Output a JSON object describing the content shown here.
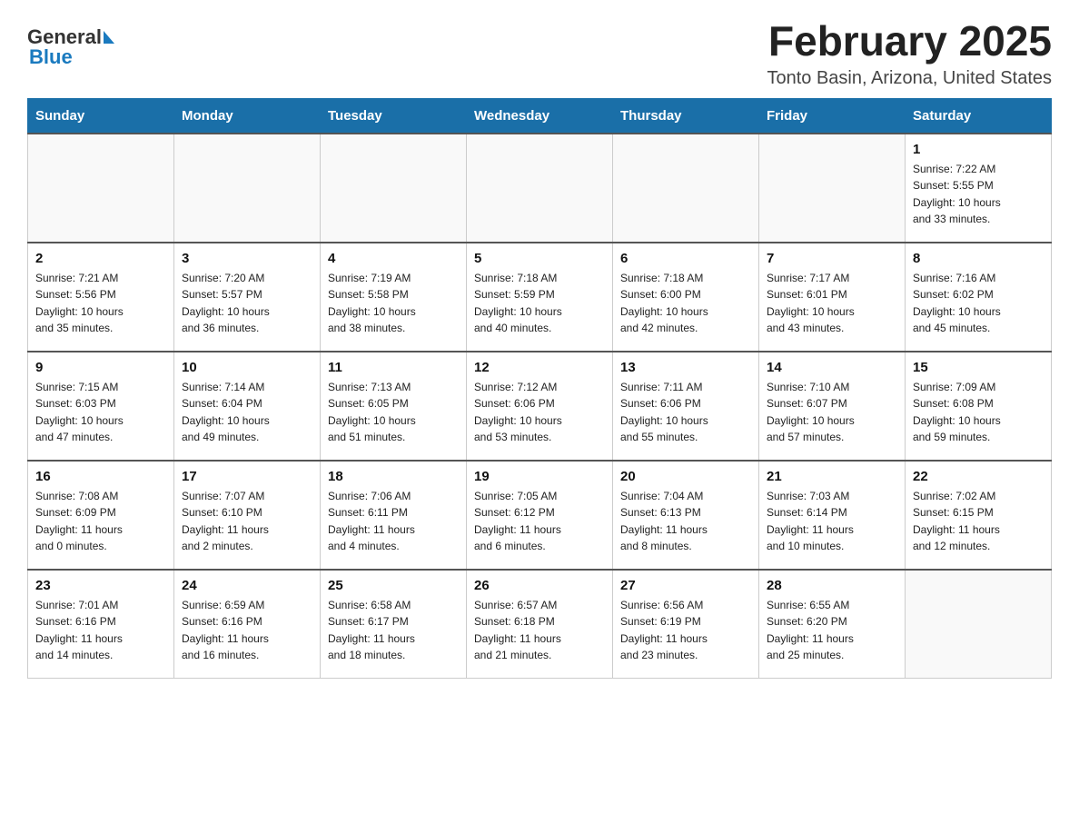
{
  "header": {
    "logo_general": "General",
    "logo_blue": "Blue",
    "month_title": "February 2025",
    "location": "Tonto Basin, Arizona, United States"
  },
  "days_of_week": [
    "Sunday",
    "Monday",
    "Tuesday",
    "Wednesday",
    "Thursday",
    "Friday",
    "Saturday"
  ],
  "weeks": [
    [
      {
        "day": "",
        "info": ""
      },
      {
        "day": "",
        "info": ""
      },
      {
        "day": "",
        "info": ""
      },
      {
        "day": "",
        "info": ""
      },
      {
        "day": "",
        "info": ""
      },
      {
        "day": "",
        "info": ""
      },
      {
        "day": "1",
        "info": "Sunrise: 7:22 AM\nSunset: 5:55 PM\nDaylight: 10 hours\nand 33 minutes."
      }
    ],
    [
      {
        "day": "2",
        "info": "Sunrise: 7:21 AM\nSunset: 5:56 PM\nDaylight: 10 hours\nand 35 minutes."
      },
      {
        "day": "3",
        "info": "Sunrise: 7:20 AM\nSunset: 5:57 PM\nDaylight: 10 hours\nand 36 minutes."
      },
      {
        "day": "4",
        "info": "Sunrise: 7:19 AM\nSunset: 5:58 PM\nDaylight: 10 hours\nand 38 minutes."
      },
      {
        "day": "5",
        "info": "Sunrise: 7:18 AM\nSunset: 5:59 PM\nDaylight: 10 hours\nand 40 minutes."
      },
      {
        "day": "6",
        "info": "Sunrise: 7:18 AM\nSunset: 6:00 PM\nDaylight: 10 hours\nand 42 minutes."
      },
      {
        "day": "7",
        "info": "Sunrise: 7:17 AM\nSunset: 6:01 PM\nDaylight: 10 hours\nand 43 minutes."
      },
      {
        "day": "8",
        "info": "Sunrise: 7:16 AM\nSunset: 6:02 PM\nDaylight: 10 hours\nand 45 minutes."
      }
    ],
    [
      {
        "day": "9",
        "info": "Sunrise: 7:15 AM\nSunset: 6:03 PM\nDaylight: 10 hours\nand 47 minutes."
      },
      {
        "day": "10",
        "info": "Sunrise: 7:14 AM\nSunset: 6:04 PM\nDaylight: 10 hours\nand 49 minutes."
      },
      {
        "day": "11",
        "info": "Sunrise: 7:13 AM\nSunset: 6:05 PM\nDaylight: 10 hours\nand 51 minutes."
      },
      {
        "day": "12",
        "info": "Sunrise: 7:12 AM\nSunset: 6:06 PM\nDaylight: 10 hours\nand 53 minutes."
      },
      {
        "day": "13",
        "info": "Sunrise: 7:11 AM\nSunset: 6:06 PM\nDaylight: 10 hours\nand 55 minutes."
      },
      {
        "day": "14",
        "info": "Sunrise: 7:10 AM\nSunset: 6:07 PM\nDaylight: 10 hours\nand 57 minutes."
      },
      {
        "day": "15",
        "info": "Sunrise: 7:09 AM\nSunset: 6:08 PM\nDaylight: 10 hours\nand 59 minutes."
      }
    ],
    [
      {
        "day": "16",
        "info": "Sunrise: 7:08 AM\nSunset: 6:09 PM\nDaylight: 11 hours\nand 0 minutes."
      },
      {
        "day": "17",
        "info": "Sunrise: 7:07 AM\nSunset: 6:10 PM\nDaylight: 11 hours\nand 2 minutes."
      },
      {
        "day": "18",
        "info": "Sunrise: 7:06 AM\nSunset: 6:11 PM\nDaylight: 11 hours\nand 4 minutes."
      },
      {
        "day": "19",
        "info": "Sunrise: 7:05 AM\nSunset: 6:12 PM\nDaylight: 11 hours\nand 6 minutes."
      },
      {
        "day": "20",
        "info": "Sunrise: 7:04 AM\nSunset: 6:13 PM\nDaylight: 11 hours\nand 8 minutes."
      },
      {
        "day": "21",
        "info": "Sunrise: 7:03 AM\nSunset: 6:14 PM\nDaylight: 11 hours\nand 10 minutes."
      },
      {
        "day": "22",
        "info": "Sunrise: 7:02 AM\nSunset: 6:15 PM\nDaylight: 11 hours\nand 12 minutes."
      }
    ],
    [
      {
        "day": "23",
        "info": "Sunrise: 7:01 AM\nSunset: 6:16 PM\nDaylight: 11 hours\nand 14 minutes."
      },
      {
        "day": "24",
        "info": "Sunrise: 6:59 AM\nSunset: 6:16 PM\nDaylight: 11 hours\nand 16 minutes."
      },
      {
        "day": "25",
        "info": "Sunrise: 6:58 AM\nSunset: 6:17 PM\nDaylight: 11 hours\nand 18 minutes."
      },
      {
        "day": "26",
        "info": "Sunrise: 6:57 AM\nSunset: 6:18 PM\nDaylight: 11 hours\nand 21 minutes."
      },
      {
        "day": "27",
        "info": "Sunrise: 6:56 AM\nSunset: 6:19 PM\nDaylight: 11 hours\nand 23 minutes."
      },
      {
        "day": "28",
        "info": "Sunrise: 6:55 AM\nSunset: 6:20 PM\nDaylight: 11 hours\nand 25 minutes."
      },
      {
        "day": "",
        "info": ""
      }
    ]
  ]
}
